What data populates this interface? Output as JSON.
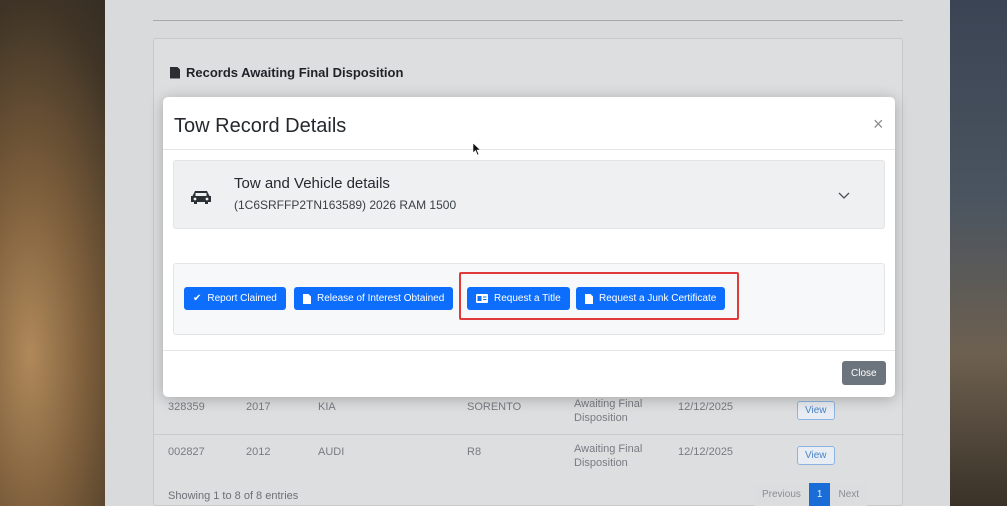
{
  "page": {
    "card_title": "Records Awaiting Final Disposition",
    "rows": [
      {
        "id": "328359",
        "year": "2017",
        "make": "KIA",
        "model": "SORENTO",
        "status_line1": "Awaiting Final",
        "status_line2": "Disposition",
        "date": "12/12/2025",
        "action": "View"
      },
      {
        "id": "002827",
        "year": "2012",
        "make": "AUDI",
        "model": "R8",
        "status_line1": "Awaiting Final",
        "status_line2": "Disposition",
        "date": "12/12/2025",
        "action": "View"
      }
    ],
    "footer_text": "Showing 1 to 8 of 8 entries",
    "pager": {
      "previous": "Previous",
      "current": "1",
      "next": "Next"
    }
  },
  "modal": {
    "title": "Tow Record Details",
    "close_glyph": "×",
    "accordion": {
      "title": "Tow and Vehicle details",
      "subtitle": "(1C6SRFFP2TN163589)  2026 RAM 1500",
      "icon": "car-icon"
    },
    "buttons": {
      "report_claimed": "Report Claimed",
      "release_of_interest": "Release of Interest Obtained",
      "request_title": "Request a Title",
      "request_junk": "Request a Junk Certificate"
    },
    "close_button": "Close"
  },
  "colors": {
    "primary": "#0d6efd",
    "secondary": "#6c757d",
    "highlight": "#e03a3a"
  }
}
